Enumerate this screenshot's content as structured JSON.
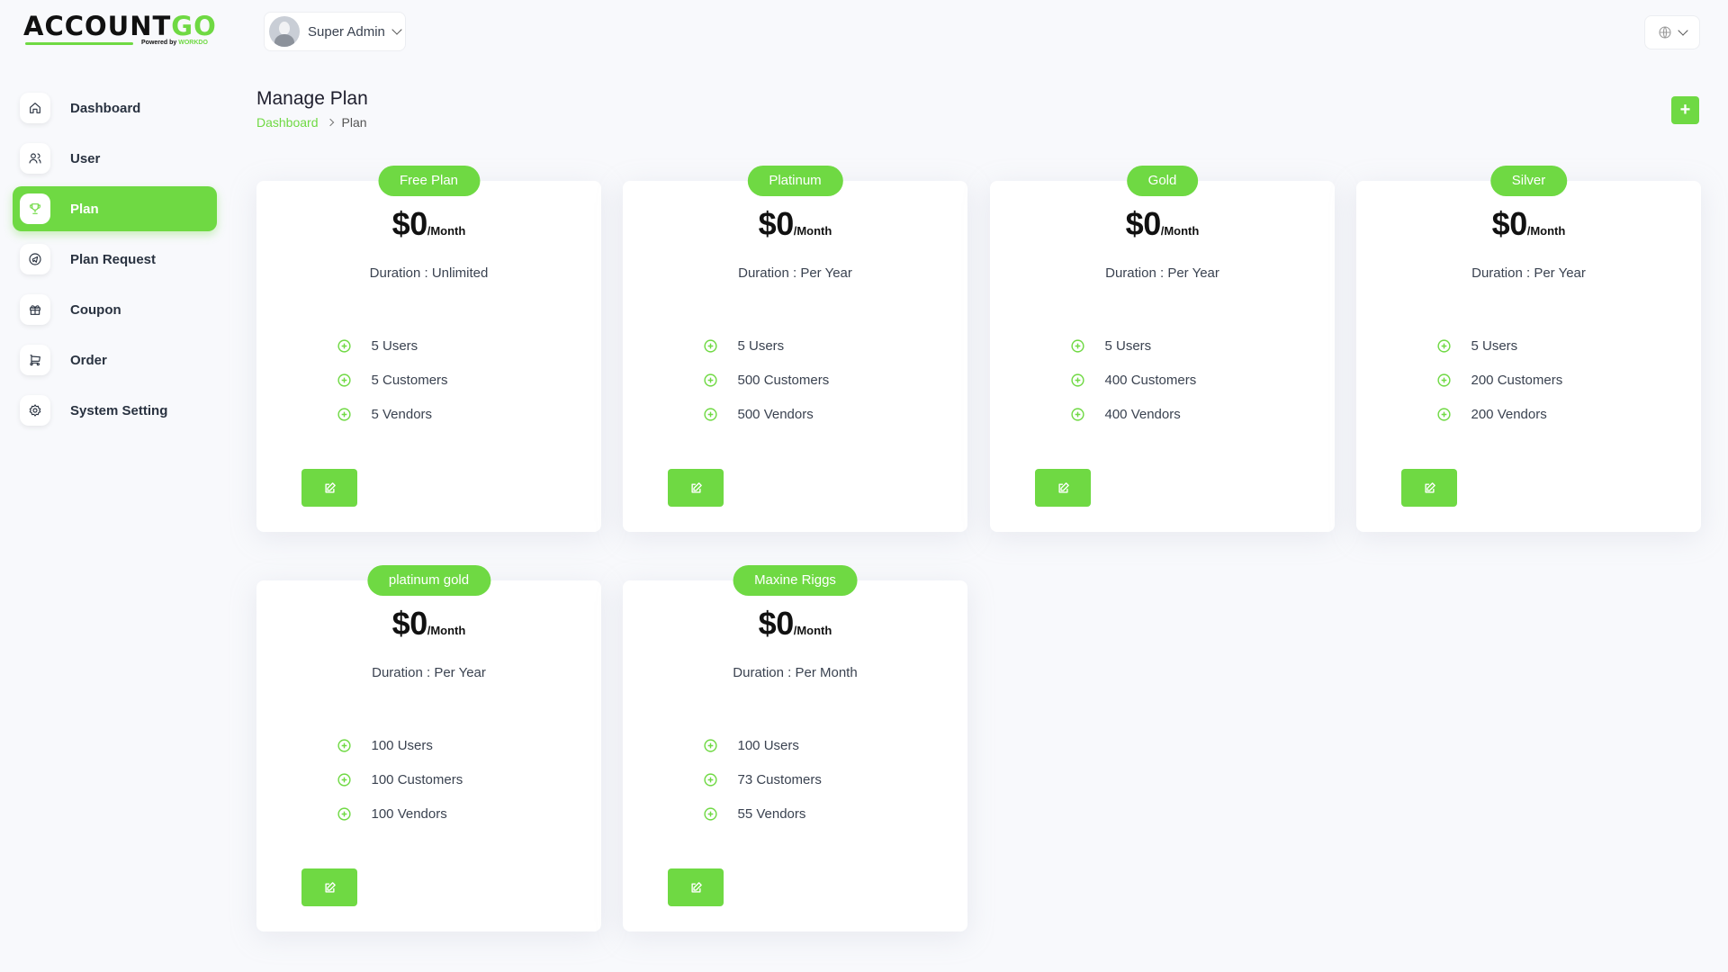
{
  "brand": {
    "logo_main": "ACCOUNT",
    "logo_accent": "GO",
    "powered_prefix": "Powered by",
    "powered_brand": "WORKDO"
  },
  "header": {
    "user_name": "Super Admin",
    "avatar_icon": "user-avatar",
    "language_icon": "globe-icon"
  },
  "sidebar": {
    "items": [
      {
        "label": "Dashboard",
        "icon": "home-icon",
        "active": false
      },
      {
        "label": "User",
        "icon": "users-icon",
        "active": false
      },
      {
        "label": "Plan",
        "icon": "trophy-icon",
        "active": true
      },
      {
        "label": "Plan Request",
        "icon": "brand-telegram-icon",
        "active": false
      },
      {
        "label": "Coupon",
        "icon": "gift-icon",
        "active": false
      },
      {
        "label": "Order",
        "icon": "cart-icon",
        "active": false
      },
      {
        "label": "System Setting",
        "icon": "settings-icon",
        "active": false
      }
    ]
  },
  "page": {
    "title": "Manage Plan",
    "breadcrumb": {
      "home": "Dashboard",
      "current": "Plan"
    },
    "add_label": "+"
  },
  "plans": [
    {
      "name": "Free Plan",
      "price": "$0",
      "period": "/Month",
      "duration": "Duration : Unlimited",
      "features": [
        "5 Users",
        "5 Customers",
        "5 Vendors"
      ]
    },
    {
      "name": "Platinum",
      "price": "$0",
      "period": "/Month",
      "duration": "Duration : Per Year",
      "features": [
        "5 Users",
        "500 Customers",
        "500 Vendors"
      ]
    },
    {
      "name": "Gold",
      "price": "$0",
      "period": "/Month",
      "duration": "Duration : Per Year",
      "features": [
        "5 Users",
        "400 Customers",
        "400 Vendors"
      ]
    },
    {
      "name": "Silver",
      "price": "$0",
      "period": "/Month",
      "duration": "Duration : Per Year",
      "features": [
        "5 Users",
        "200 Customers",
        "200 Vendors"
      ]
    },
    {
      "name": "platinum gold",
      "price": "$0",
      "period": "/Month",
      "duration": "Duration : Per Year",
      "features": [
        "100 Users",
        "100 Customers",
        "100 Vendors"
      ]
    },
    {
      "name": "Maxine Riggs",
      "price": "$0",
      "period": "/Month",
      "duration": "Duration : Per Month",
      "features": [
        "100 Users",
        "73 Customers",
        "55 Vendors"
      ]
    }
  ],
  "colors": {
    "accent": "#6fd943",
    "text": "#293240",
    "background": "#f8f9fc"
  }
}
